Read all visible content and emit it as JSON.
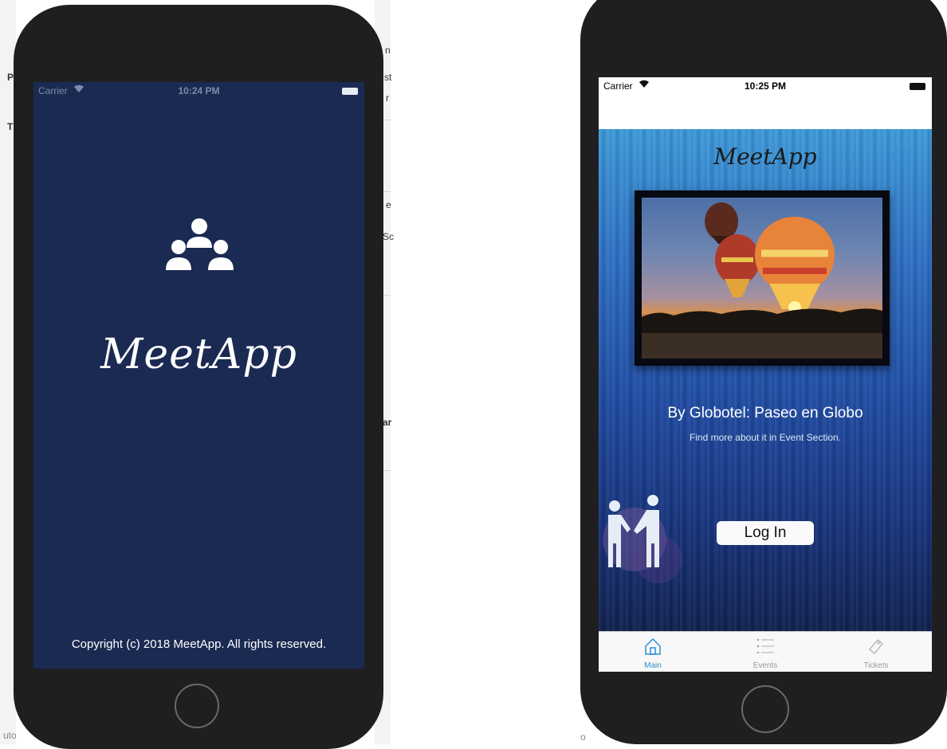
{
  "splash": {
    "status": {
      "carrier": "Carrier",
      "time": "10:24 PM"
    },
    "app_name": "MeetApp",
    "copyright": "Copyright (c) 2018 MeetApp. All rights reserved.",
    "icon": "people-group-icon"
  },
  "main": {
    "status": {
      "carrier": "Carrier",
      "time": "10:25 PM"
    },
    "app_name": "MeetApp",
    "info_icon": "info-icon",
    "event_title": "By Globotel: Paseo en Globo",
    "event_subtitle": "Find more about it in Event Section.",
    "login_label": "Log In",
    "tabs": [
      {
        "label": "Main",
        "icon": "home-icon",
        "active": true
      },
      {
        "label": "Events",
        "icon": "list-icon",
        "active": false
      },
      {
        "label": "Tickets",
        "icon": "ticket-icon",
        "active": false
      }
    ],
    "accent_color": "#2d8fd6"
  },
  "background": {
    "fragments": [
      "n",
      "P",
      "T",
      "st",
      "r",
      "e",
      "Sc",
      "ar",
      "uto",
      "o"
    ]
  }
}
